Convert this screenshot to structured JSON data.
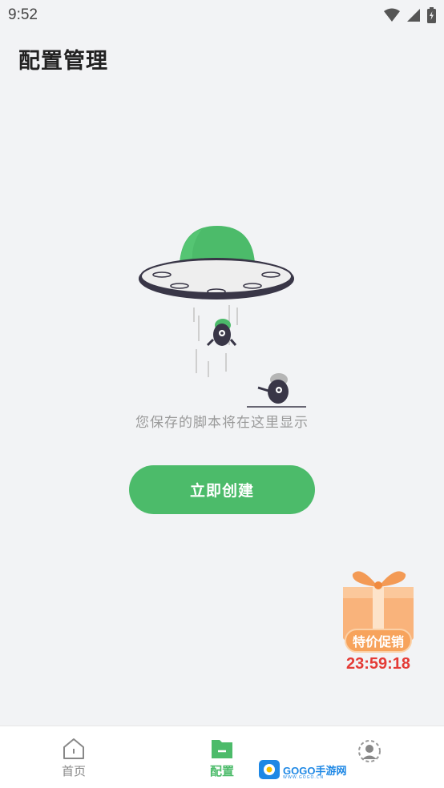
{
  "status_bar": {
    "time": "9:52",
    "icons": [
      "wifi-icon",
      "signal-icon",
      "battery-charging-icon"
    ]
  },
  "header": {
    "title": "配置管理"
  },
  "empty_state": {
    "illustration": "ufo-illustration",
    "message": "您保存的脚本将在这里显示",
    "create_button_label": "立即创建"
  },
  "promo": {
    "icon": "gift-box-icon",
    "badge_label": "特价促销",
    "countdown": "23:59:18"
  },
  "bottom_nav": {
    "items": [
      {
        "label": "首页",
        "icon": "home-icon",
        "active": false
      },
      {
        "label": "配置",
        "icon": "folder-icon",
        "active": true
      },
      {
        "label": "",
        "icon": "profile-icon",
        "active": false
      }
    ]
  },
  "watermark": {
    "text": "GOGO手游网",
    "subtext": "WWW.GOGO.CN"
  },
  "colors": {
    "accent": "#4cbb6a",
    "background": "#f2f3f5",
    "promo_orange": "#f7a35c",
    "countdown_red": "#e43b36"
  }
}
